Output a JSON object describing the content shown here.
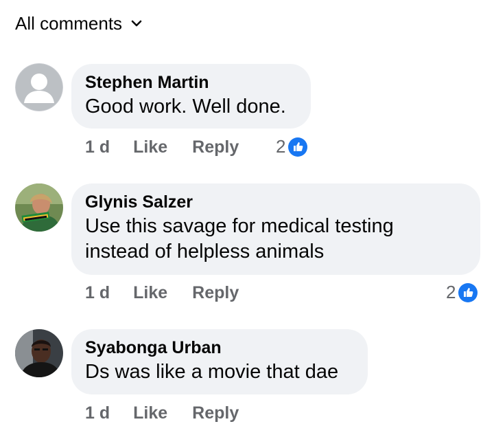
{
  "filter": {
    "label": "All comments"
  },
  "comments": [
    {
      "author": "Stephen Martin",
      "text": "Good work. Well done.",
      "time": "1 d",
      "like_label": "Like",
      "reply_label": "Reply",
      "reaction_count": "2"
    },
    {
      "author": "Glynis Salzer",
      "text": "Use this savage for medical testing instead of helpless animals",
      "time": "1 d",
      "like_label": "Like",
      "reply_label": "Reply",
      "reaction_count": "2"
    },
    {
      "author": "Syabonga Urban",
      "text": "Ds was like a movie that dae",
      "time": "1 d",
      "like_label": "Like",
      "reply_label": "Reply"
    }
  ],
  "colors": {
    "bubble": "#f0f2f5",
    "secondary_text": "#65676b",
    "like_blue": "#1877f2"
  }
}
